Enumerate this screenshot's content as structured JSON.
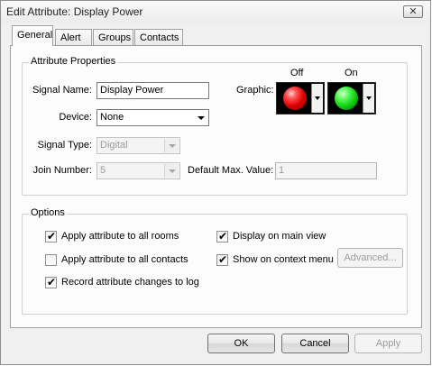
{
  "window": {
    "title": "Edit Attribute: Display Power",
    "close_glyph": "✕"
  },
  "tabs": [
    {
      "label": "General",
      "active": true
    },
    {
      "label": "Alert",
      "active": false
    },
    {
      "label": "Groups",
      "active": false
    },
    {
      "label": "Contacts",
      "active": false
    }
  ],
  "attribute_properties": {
    "legend": "Attribute Properties",
    "signal_name": {
      "label": "Signal Name:",
      "value": "Display Power"
    },
    "device": {
      "label": "Device:",
      "value": "None"
    },
    "signal_type": {
      "label": "Signal Type:",
      "value": "Digital",
      "enabled": false
    },
    "join_number": {
      "label": "Join Number:",
      "value": "5",
      "enabled": false
    },
    "default_max_value": {
      "label": "Default Max. Value:",
      "value": "1",
      "enabled": false
    },
    "graphic": {
      "label": "Graphic:",
      "off": {
        "label": "Off",
        "color": "#e00000",
        "icon": "red-led-icon"
      },
      "on": {
        "label": "On",
        "color": "#14d414",
        "icon": "green-led-icon"
      }
    }
  },
  "options": {
    "legend": "Options",
    "apply_all_rooms": {
      "label": "Apply attribute to all rooms",
      "checked": true
    },
    "apply_all_contacts": {
      "label": "Apply attribute to all contacts",
      "checked": false
    },
    "record_changes": {
      "label": "Record attribute changes to log",
      "checked": true
    },
    "display_main_view": {
      "label": "Display on main view",
      "checked": true
    },
    "show_context_menu": {
      "label": "Show on context menu",
      "checked": true
    },
    "advanced_label": "Advanced..."
  },
  "footer": {
    "ok_label": "OK",
    "cancel_label": "Cancel",
    "apply_label": "Apply"
  },
  "check_glyph": "✔"
}
